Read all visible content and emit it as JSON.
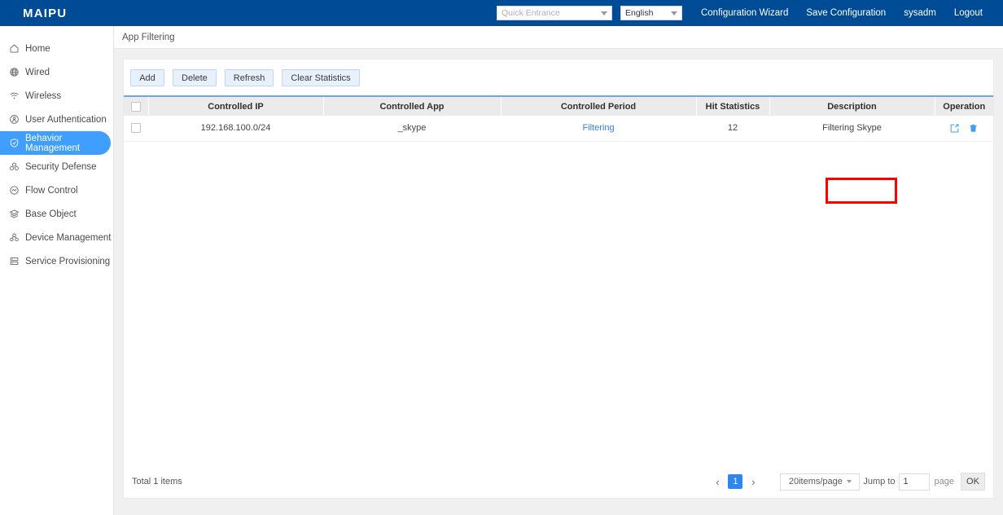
{
  "brand": {
    "name": "MAIPU"
  },
  "topbar": {
    "quick_entrance_placeholder": "Quick Entrance",
    "language_value": "English",
    "links": [
      {
        "label": "Configuration Wizard",
        "name": "configuration-wizard-link"
      },
      {
        "label": "Save Configuration",
        "name": "save-configuration-link"
      },
      {
        "label": "sysadm",
        "name": "user-account-link"
      },
      {
        "label": "Logout",
        "name": "logout-link"
      }
    ]
  },
  "sidebar": {
    "items": [
      {
        "label": "Home",
        "icon": "home-icon",
        "active": false
      },
      {
        "label": "Wired",
        "icon": "globe-icon",
        "active": false
      },
      {
        "label": "Wireless",
        "icon": "wifi-icon",
        "active": false
      },
      {
        "label": "User Authentication",
        "icon": "user-badge-icon",
        "active": false
      },
      {
        "label": "Behavior Management",
        "icon": "shield-check-icon",
        "active": true
      },
      {
        "label": "Security Defense",
        "icon": "security-nodes-icon",
        "active": false
      },
      {
        "label": "Flow Control",
        "icon": "flow-circle-icon",
        "active": false
      },
      {
        "label": "Base Object",
        "icon": "layers-icon",
        "active": false
      },
      {
        "label": "Device Management",
        "icon": "device-nodes-icon",
        "active": false
      },
      {
        "label": "Service Provisioning",
        "icon": "server-stack-icon",
        "active": false
      }
    ]
  },
  "breadcrumb": {
    "title": "App Filtering"
  },
  "toolbar": {
    "buttons": [
      {
        "label": "Add",
        "name": "add-button"
      },
      {
        "label": "Delete",
        "name": "delete-button"
      },
      {
        "label": "Refresh",
        "name": "refresh-button"
      },
      {
        "label": "Clear Statistics",
        "name": "clear-statistics-button"
      }
    ]
  },
  "table": {
    "columns": [
      {
        "key": "select",
        "label": ""
      },
      {
        "key": "controlled_ip",
        "label": "Controlled IP"
      },
      {
        "key": "controlled_app",
        "label": "Controlled App"
      },
      {
        "key": "controlled_period",
        "label": "Controlled Period"
      },
      {
        "key": "hit_statistics",
        "label": "Hit Statistics"
      },
      {
        "key": "description",
        "label": "Description"
      },
      {
        "key": "operation",
        "label": "Operation"
      }
    ],
    "rows": [
      {
        "controlled_ip": "192.168.100.0/24",
        "controlled_app": "_skype",
        "controlled_period": "Filtering",
        "hit_statistics": "12",
        "description": "Filtering Skype",
        "edit_icon": "edit-icon",
        "delete_icon": "trash-icon"
      }
    ]
  },
  "annotation": {
    "highlight_color": "#ff0000",
    "target": "hit-statistics-cell"
  },
  "footer": {
    "total_text": "Total 1 items",
    "prev_arrow": "‹",
    "next_arrow": "›",
    "current_page": "1",
    "page_size_value": "20items/page",
    "jump_label": "Jump to",
    "jump_value": "1",
    "page_label": "page",
    "ok_label": "OK"
  },
  "colors": {
    "header_blue": "#004b95",
    "active_blue": "#409eff",
    "link_blue": "#3d7fd4",
    "button_blue_bg": "#e8f0fb",
    "highlight_red": "#ff0000"
  }
}
